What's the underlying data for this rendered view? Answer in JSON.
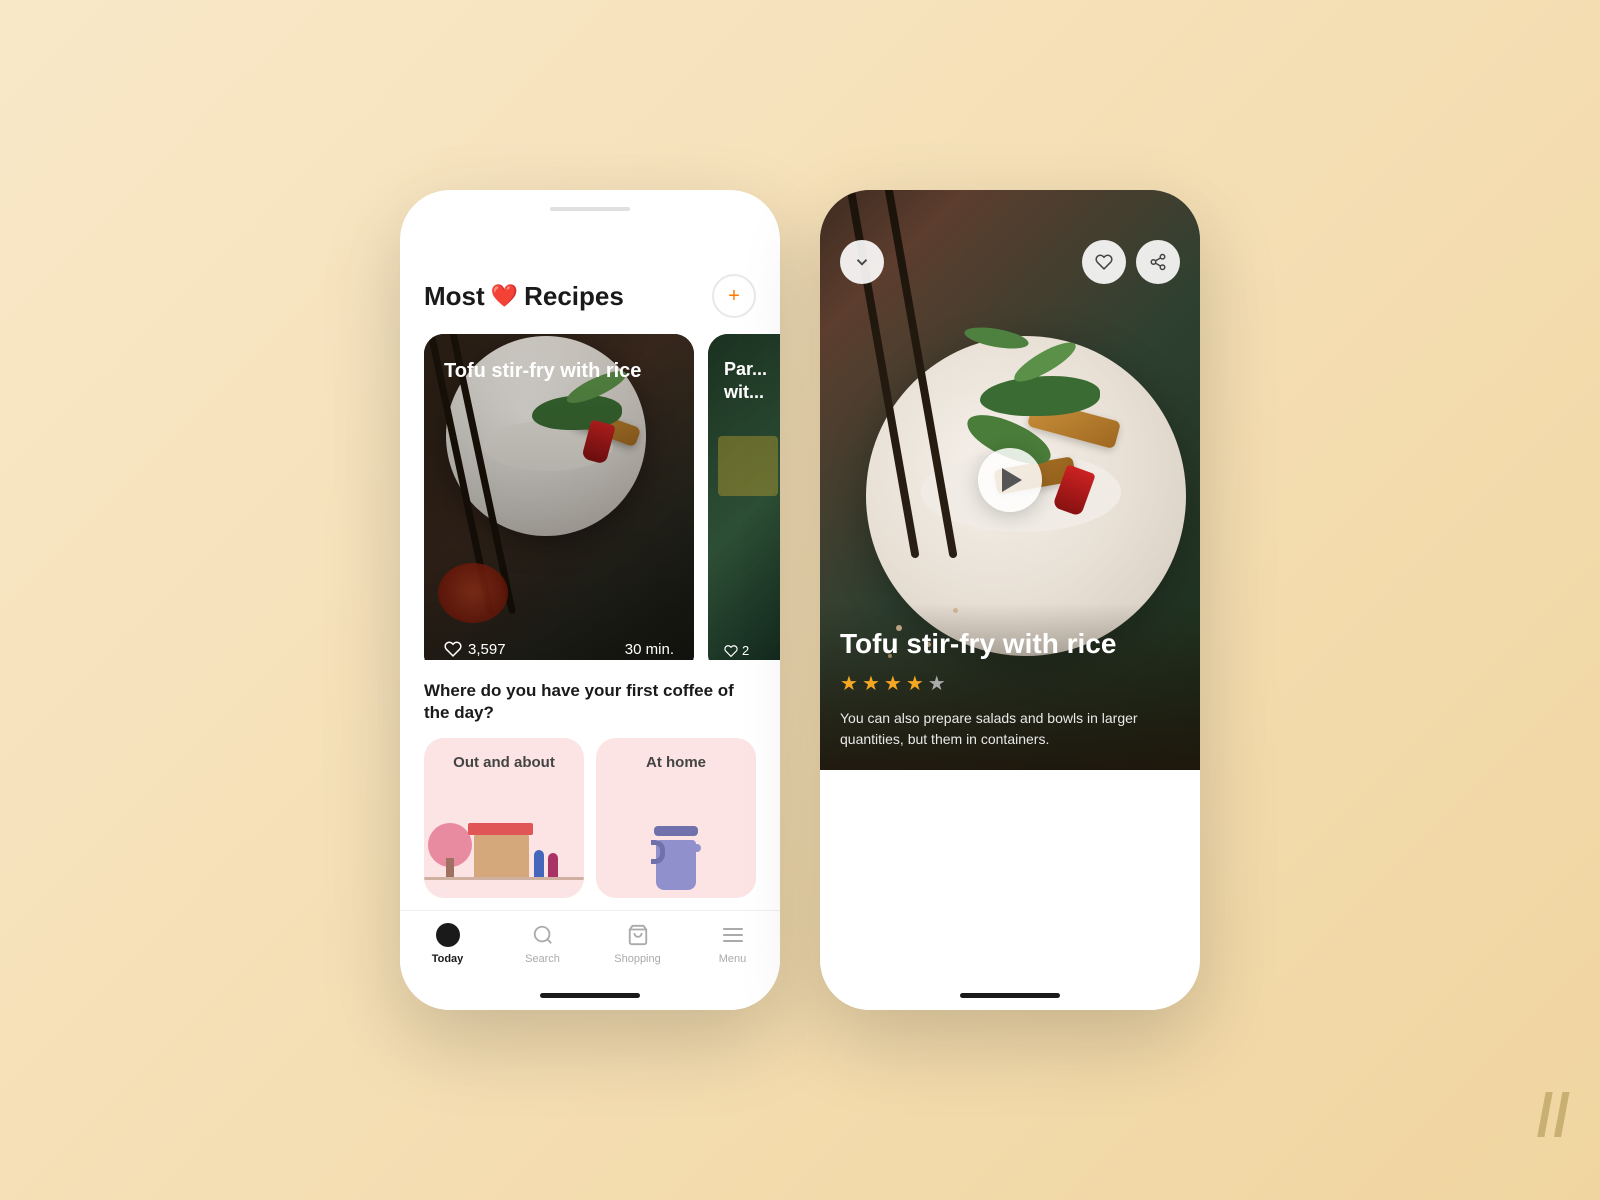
{
  "background_color": "#f5deb3",
  "phone1": {
    "header": {
      "title_part1": "Most",
      "title_part2": "Recipes",
      "add_btn_label": "+"
    },
    "recipes": [
      {
        "title": "Tofu stir-fry with rice",
        "likes": "3,597",
        "time": "30 min."
      },
      {
        "title": "Par...",
        "likes": "2"
      }
    ],
    "coffee_section": {
      "question": "Where do you have your first coffee of the day?",
      "options": [
        {
          "label": "Out and about"
        },
        {
          "label": "At home"
        }
      ]
    },
    "bottom_nav": [
      {
        "label": "Today",
        "active": true
      },
      {
        "label": "Search",
        "active": false
      },
      {
        "label": "Shopping",
        "active": false
      },
      {
        "label": "Menu",
        "active": false
      }
    ]
  },
  "phone2": {
    "recipe": {
      "title": "Tofu stir-fry with rice",
      "rating": 4,
      "max_rating": 5,
      "description": "You can also prepare salads and bowls in larger quantities, but them in containers."
    },
    "actions": {
      "back": "chevron-down",
      "like": "heart",
      "share": "share"
    }
  },
  "deco": {
    "slash": "//"
  }
}
